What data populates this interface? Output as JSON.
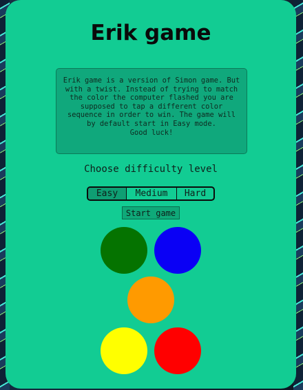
{
  "title": "Erik game",
  "description": "Erik game is a version of Simon game. But\nwith a twist. Instead of trying to match\nthe color the computer flashed you are\nsupposed to tap a different color\nsequence in order to win. The game will\nby default start in Easy mode.\nGood luck!",
  "difficulty": {
    "prompt": "Choose difficulty level",
    "options": [
      "Easy",
      "Medium",
      "Hard"
    ],
    "selected": "Easy"
  },
  "start_label": "Start game",
  "pads": [
    {
      "name": "green",
      "color": "#057300"
    },
    {
      "name": "blue",
      "color": "#0a00f5"
    },
    {
      "name": "orange",
      "color": "#ff9a00"
    },
    {
      "name": "yellow",
      "color": "#ffff00"
    },
    {
      "name": "red",
      "color": "#ff0000"
    }
  ],
  "colors": {
    "card": "#12cc93",
    "selected_option": "#0f9e73"
  }
}
